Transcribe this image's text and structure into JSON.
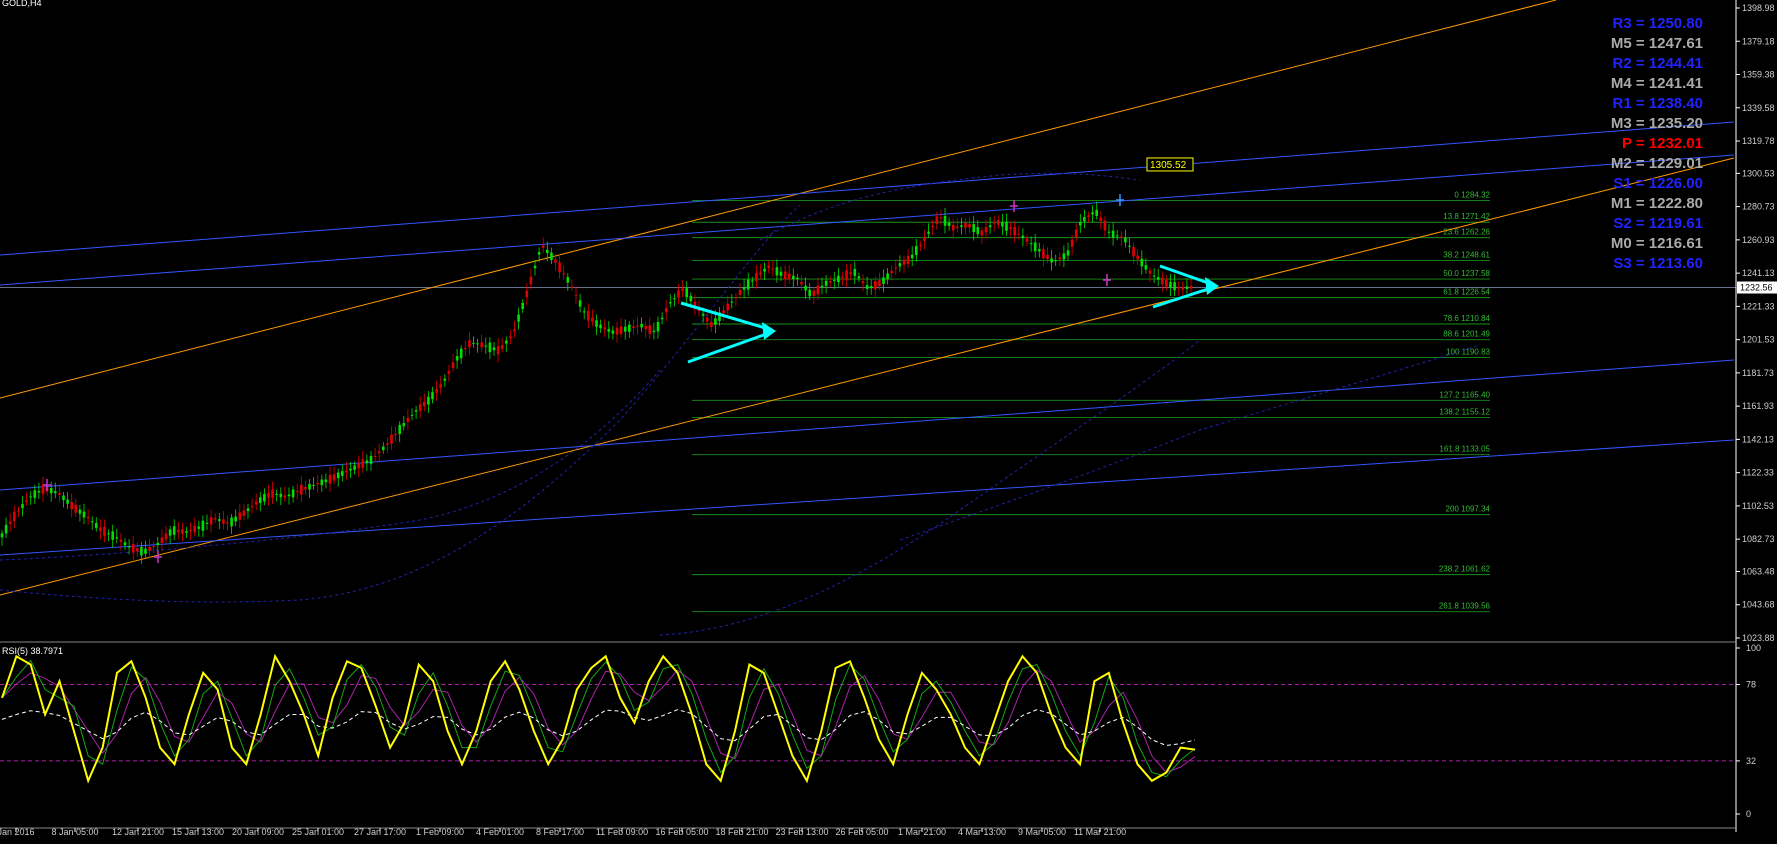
{
  "window": {
    "symbol_label": "GOLD,H4"
  },
  "colors": {
    "background": "#000000",
    "price_axis_border": "#ffffff",
    "bull_candle": "#00e000",
    "bear_candle": "#e00000",
    "fib": "#1a8f1a",
    "fib_text": "#33bb33",
    "orange_line": "#ff9900",
    "blue_line": "#3355ff",
    "dotted_band": "#2222aa",
    "arrow": "#00ffff",
    "rsi_main": "#ffff00",
    "rsi_signal_green": "#11aa11",
    "rsi_signal_magenta": "#aa22aa",
    "rsi_avg": "#ffffff",
    "rsi_level": "#aa22aa",
    "pivot_blue": "#2222ff",
    "pivot_grey": "#aaaaaa",
    "pivot_red": "#ff0000"
  },
  "chart_data": [
    {
      "type": "candlestick",
      "title": "GOLD,H4",
      "y_ticks": [
        "1398.98",
        "1379.18",
        "1359.38",
        "1339.58",
        "1319.78",
        "1300.53",
        "1280.73",
        "1260.93",
        "1241.13",
        "1221.33",
        "1201.53",
        "1181.73",
        "1161.93",
        "1142.13",
        "1122.33",
        "1102.53",
        "1082.73",
        "1063.48",
        "1043.68",
        "1023.88"
      ],
      "ylim": [
        1017,
        1402
      ],
      "x_tick_labels": [
        "Jan 2016",
        "8 Jan 05:00",
        "12 Jan 21:00",
        "15 Jan 13:00",
        "20 Jan 09:00",
        "25 Jan 01:00",
        "27 Jan 17:00",
        "1 Feb 09:00",
        "4 Feb 01:00",
        "8 Feb 17:00",
        "11 Feb 09:00",
        "16 Feb 05:00",
        "18 Feb 21:00",
        "23 Feb 13:00",
        "26 Feb 05:00",
        "1 Mar 21:00",
        "4 Mar 13:00",
        "9 Mar 05:00",
        "11 Mar 21:00"
      ],
      "current_price": "1232.56",
      "price_tag": "1305.52",
      "close_path": [
        [
          0,
          1085
        ],
        [
          10,
          1098
        ],
        [
          20,
          1108
        ],
        [
          30,
          1113
        ],
        [
          40,
          1110
        ],
        [
          50,
          1102
        ],
        [
          60,
          1096
        ],
        [
          70,
          1088
        ],
        [
          80,
          1084
        ],
        [
          90,
          1078
        ],
        [
          100,
          1075
        ],
        [
          110,
          1080
        ],
        [
          120,
          1088
        ],
        [
          130,
          1087
        ],
        [
          140,
          1090
        ],
        [
          150,
          1095
        ],
        [
          160,
          1092
        ],
        [
          170,
          1098
        ],
        [
          180,
          1105
        ],
        [
          190,
          1110
        ],
        [
          200,
          1108
        ],
        [
          210,
          1112
        ],
        [
          220,
          1115
        ],
        [
          230,
          1118
        ],
        [
          240,
          1122
        ],
        [
          250,
          1126
        ],
        [
          260,
          1130
        ],
        [
          270,
          1138
        ],
        [
          280,
          1148
        ],
        [
          290,
          1158
        ],
        [
          300,
          1165
        ],
        [
          310,
          1175
        ],
        [
          320,
          1190
        ],
        [
          330,
          1200
        ],
        [
          340,
          1198
        ],
        [
          350,
          1195
        ],
        [
          360,
          1205
        ],
        [
          370,
          1230
        ],
        [
          380,
          1258
        ],
        [
          390,
          1248
        ],
        [
          400,
          1235
        ],
        [
          410,
          1218
        ],
        [
          420,
          1210
        ],
        [
          430,
          1206
        ],
        [
          440,
          1208
        ],
        [
          450,
          1210
        ],
        [
          460,
          1206
        ],
        [
          470,
          1223
        ],
        [
          480,
          1232
        ],
        [
          490,
          1220
        ],
        [
          500,
          1210
        ],
        [
          510,
          1220
        ],
        [
          520,
          1230
        ],
        [
          530,
          1238
        ],
        [
          540,
          1245
        ],
        [
          550,
          1240
        ],
        [
          560,
          1238
        ],
        [
          570,
          1228
        ],
        [
          580,
          1235
        ],
        [
          590,
          1238
        ],
        [
          600,
          1242
        ],
        [
          610,
          1232
        ],
        [
          620,
          1236
        ],
        [
          630,
          1245
        ],
        [
          640,
          1250
        ],
        [
          650,
          1262
        ],
        [
          660,
          1275
        ],
        [
          670,
          1268
        ],
        [
          680,
          1270
        ],
        [
          690,
          1265
        ],
        [
          700,
          1272
        ],
        [
          710,
          1268
        ],
        [
          720,
          1262
        ],
        [
          730,
          1255
        ],
        [
          740,
          1248
        ],
        [
          750,
          1252
        ],
        [
          760,
          1272
        ],
        [
          770,
          1278
        ],
        [
          780,
          1265
        ],
        [
          790,
          1262
        ],
        [
          800,
          1250
        ],
        [
          810,
          1240
        ],
        [
          820,
          1235
        ],
        [
          830,
          1232
        ],
        [
          840,
          1233
        ]
      ],
      "fibonacci": [
        {
          "label": "0",
          "value": "1284.32"
        },
        {
          "label": "13.8",
          "value": "1271.42"
        },
        {
          "label": "23.6",
          "value": "1262.26"
        },
        {
          "label": "38.2",
          "value": "1248.61"
        },
        {
          "label": "50.0",
          "value": "1237.58"
        },
        {
          "label": "61.8",
          "value": "1226.54"
        },
        {
          "label": "78.6",
          "value": "1210.84"
        },
        {
          "label": "88.6",
          "value": "1201.49"
        },
        {
          "label": "100",
          "value": "1190.83"
        },
        {
          "label": "127.2",
          "value": "1165.40"
        },
        {
          "label": "138.2",
          "value": "1155.12"
        },
        {
          "label": "161.8",
          "value": "1133.05"
        },
        {
          "label": "200",
          "value": "1097.34"
        },
        {
          "label": "238.2",
          "value": "1061.62"
        },
        {
          "label": "261.8",
          "value": "1039.56"
        }
      ],
      "pivots": [
        {
          "label": "R3",
          "value": "1250.80",
          "kind": "blue"
        },
        {
          "label": "M5",
          "value": "1247.61",
          "kind": "grey"
        },
        {
          "label": "R2",
          "value": "1244.41",
          "kind": "blue"
        },
        {
          "label": "M4",
          "value": "1241.41",
          "kind": "grey"
        },
        {
          "label": "R1",
          "value": "1238.40",
          "kind": "blue"
        },
        {
          "label": "M3",
          "value": "1235.20",
          "kind": "grey"
        },
        {
          "label": "P",
          "value": "1232.01",
          "kind": "red"
        },
        {
          "label": "M2",
          "value": "1229.01",
          "kind": "grey"
        },
        {
          "label": "S1",
          "value": "1226.00",
          "kind": "blue"
        },
        {
          "label": "M1",
          "value": "1222.80",
          "kind": "grey"
        },
        {
          "label": "S2",
          "value": "1219.61",
          "kind": "blue"
        },
        {
          "label": "M0",
          "value": "1216.61",
          "kind": "grey"
        },
        {
          "label": "S3",
          "value": "1213.60",
          "kind": "blue"
        }
      ]
    },
    {
      "type": "line",
      "title": "RSI(5) 38.7971",
      "y_ticks": [
        "100",
        "78",
        "32",
        "0"
      ],
      "ylim": [
        0,
        100
      ],
      "levels": [
        78,
        32
      ],
      "series": [
        {
          "values": [
            70,
            95,
            90,
            60,
            80,
            50,
            20,
            40,
            85,
            92,
            70,
            40,
            30,
            60,
            85,
            75,
            40,
            30,
            60,
            95,
            80,
            60,
            35,
            70,
            92,
            88,
            65,
            40,
            55,
            90,
            80,
            50,
            30,
            50,
            80,
            92,
            75,
            50,
            30,
            45,
            75,
            88,
            95,
            70,
            55,
            80,
            95,
            85,
            60,
            30,
            20,
            50,
            90,
            85,
            60,
            35,
            20,
            50,
            88,
            92,
            70,
            45,
            30,
            60,
            85,
            75,
            60,
            40,
            30,
            55,
            80,
            95,
            85,
            60,
            40,
            30,
            80,
            85,
            55,
            30,
            20,
            25,
            40,
            38.8
          ]
        }
      ]
    }
  ],
  "annotations": {
    "arrow_left": "triangle-arrow",
    "arrow_right": "triangle-arrow"
  }
}
